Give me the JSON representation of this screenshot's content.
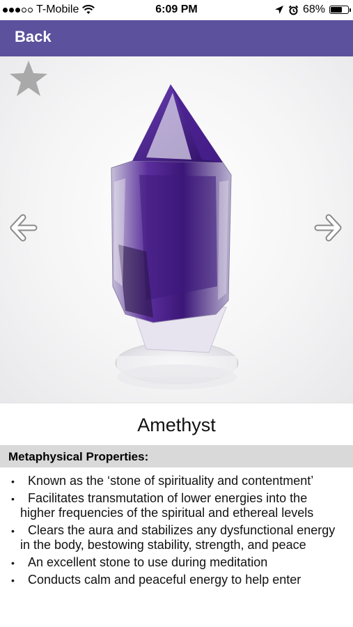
{
  "status_bar": {
    "carrier": "T-Mobile",
    "time": "6:09 PM",
    "battery_percent": "68%",
    "battery_level": 0.68,
    "signal_bars_filled": 3,
    "signal_bars_total": 5
  },
  "nav": {
    "back_label": "Back",
    "color": "#5b519c"
  },
  "gallery": {
    "favorite_icon": "star-icon",
    "prev_icon": "arrow-left-icon",
    "next_icon": "arrow-right-icon"
  },
  "stone": {
    "name": "Amethyst"
  },
  "properties_section": {
    "title": "Metaphysical Properties:",
    "items": [
      {
        "text": "Known as the ‘stone of spirituality and contentment’"
      },
      {
        "text": "Facilitates transmutation of lower energies into the higher frequencies of the spiritual and ethereal levels"
      },
      {
        "text": "Clears the aura and stabilizes any dysfunctional energy in the body, bestowing stability, strength, and peace"
      },
      {
        "text": "An excellent stone to use during meditation"
      },
      {
        "text": "Conducts calm and peaceful energy to help enter"
      }
    ]
  }
}
